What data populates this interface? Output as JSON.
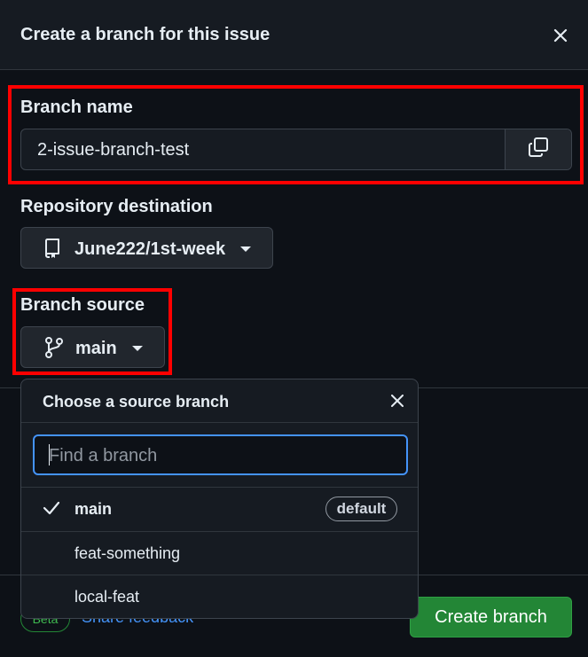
{
  "dialog": {
    "title": "Create a branch for this issue"
  },
  "branch_name": {
    "label": "Branch name",
    "value": "2-issue-branch-test"
  },
  "repository": {
    "label": "Repository destination",
    "value": "June222/1st-week"
  },
  "branch_source": {
    "label": "Branch source",
    "value": "main"
  },
  "popover": {
    "title": "Choose a source branch",
    "search_placeholder": "Find a branch",
    "branches": [
      {
        "name": "main",
        "selected": true,
        "badge": "default"
      },
      {
        "name": "feat-something",
        "selected": false
      },
      {
        "name": "local-feat",
        "selected": false
      }
    ]
  },
  "footer": {
    "beta_label": "Beta",
    "feedback_link": "Share feedback",
    "create_button": "Create branch"
  },
  "colors": {
    "highlight": "#ff0000",
    "primary_button": "#238636",
    "focus_border": "#4493f8"
  }
}
